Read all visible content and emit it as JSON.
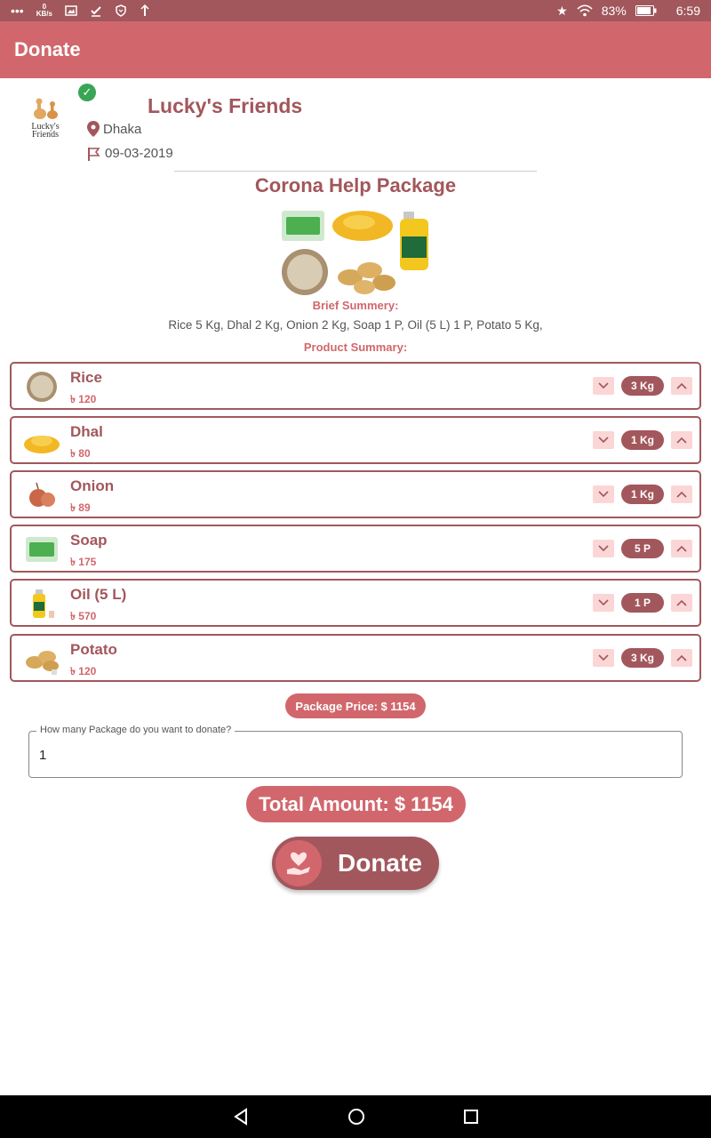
{
  "status_bar": {
    "kb_value": "0",
    "kb_unit": "KB/s",
    "battery": "83%",
    "time": "6:59"
  },
  "app_bar": {
    "title": "Donate"
  },
  "org": {
    "logo_text": "Lucky's Friends",
    "name": "Lucky's Friends",
    "location": "Dhaka",
    "date": "09-03-2019"
  },
  "package": {
    "title": "Corona Help Package",
    "brief_label": "Brief Summery:",
    "brief_text": "Rice 5 Kg, Dhal 2 Kg, Onion 2 Kg, Soap 1 P, Oil (5 L) 1 P, Potato 5 Kg,",
    "product_label": "Product Summary:"
  },
  "items": [
    {
      "name": "Rice",
      "price": "৳ 120",
      "qty": "3 Kg"
    },
    {
      "name": "Dhal",
      "price": "৳ 80",
      "qty": "1 Kg"
    },
    {
      "name": "Onion",
      "price": "৳ 89",
      "qty": "1 Kg"
    },
    {
      "name": "Soap",
      "price": "৳ 175",
      "qty": "5 P"
    },
    {
      "name": "Oil (5 L)",
      "price": "৳ 570",
      "qty": "1 P"
    },
    {
      "name": "Potato",
      "price": "৳ 120",
      "qty": "3 Kg"
    }
  ],
  "package_price": "Package Price: $ 1154",
  "quantity_field": {
    "label": "How many Package do you want to donate?",
    "value": "1"
  },
  "total_amount": "Total Amount: $ 1154",
  "donate_button": "Donate",
  "colors": {
    "primary": "#d1676c",
    "primary_dark": "#a2575c",
    "stepper_bg": "#fbd6d6",
    "verified": "#3aa655"
  }
}
